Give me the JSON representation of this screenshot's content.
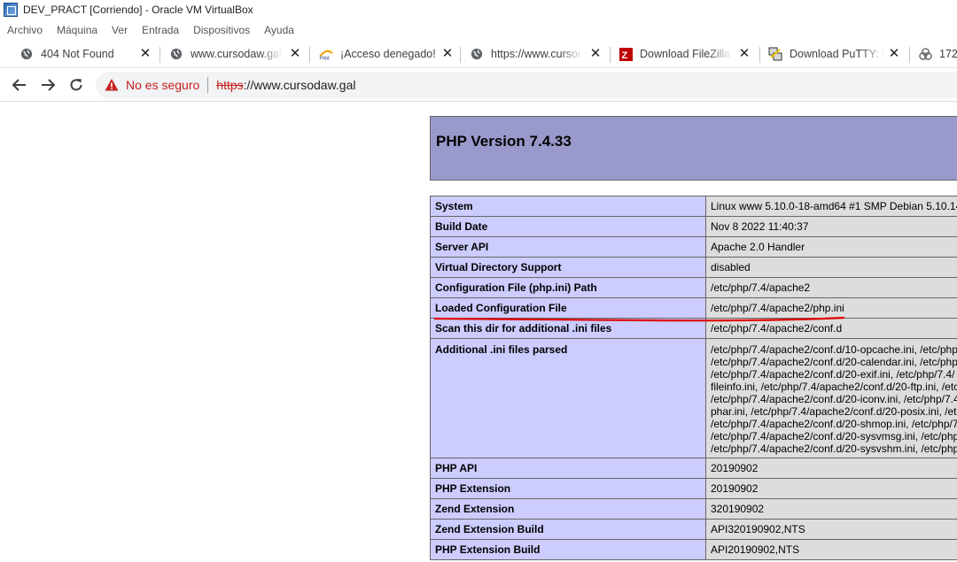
{
  "window": {
    "title": "DEV_PRACT [Corriendo] - Oracle VM VirtualBox",
    "menu": [
      "Archivo",
      "Máquina",
      "Ver",
      "Entrada",
      "Dispositivos",
      "Ayuda"
    ]
  },
  "tabs": [
    {
      "title": "404 Not Found",
      "icon": "globe-icon"
    },
    {
      "title": "www.cursodaw.galp",
      "icon": "globe-icon"
    },
    {
      "title": "¡Acceso denegado!",
      "icon": "phpmyadmin-icon"
    },
    {
      "title": "https://www.cursod",
      "icon": "globe-icon"
    },
    {
      "title": "Download FileZilla C",
      "icon": "filezilla-icon"
    },
    {
      "title": "Download PuTTY: la",
      "icon": "putty-icon"
    },
    {
      "title": "172",
      "icon": "biohazard-icon"
    }
  ],
  "address_bar": {
    "security_text": "No es seguro",
    "url_scheme": "https",
    "url_rest": "://www.cursodaw.gal"
  },
  "php": {
    "title": "PHP Version 7.4.33",
    "rows": [
      {
        "key": "System",
        "value": "Linux www 5.10.0-18-amd64 #1 SMP Debian 5.10.14"
      },
      {
        "key": "Build Date",
        "value": "Nov 8 2022 11:40:37"
      },
      {
        "key": "Server API",
        "value": "Apache 2.0 Handler"
      },
      {
        "key": "Virtual Directory Support",
        "value": "disabled"
      },
      {
        "key": "Configuration File (php.ini) Path",
        "value": "/etc/php/7.4/apache2"
      },
      {
        "key": "Loaded Configuration File",
        "value": "/etc/php/7.4/apache2/php.ini"
      },
      {
        "key": "Scan this dir for additional .ini files",
        "value": "/etc/php/7.4/apache2/conf.d"
      }
    ],
    "ini_files": {
      "key": "Additional .ini files parsed",
      "lines": [
        "/etc/php/7.4/apache2/conf.d/10-opcache.ini, /etc/php",
        "/etc/php/7.4/apache2/conf.d/20-calendar.ini, /etc/php",
        "/etc/php/7.4/apache2/conf.d/20-exif.ini, /etc/php/7.4/",
        "fileinfo.ini, /etc/php/7.4/apache2/conf.d/20-ftp.ini, /etc",
        "/etc/php/7.4/apache2/conf.d/20-iconv.ini, /etc/php/7.4",
        "phar.ini, /etc/php/7.4/apache2/conf.d/20-posix.ini, /etc",
        "/etc/php/7.4/apache2/conf.d/20-shmop.ini, /etc/php/7",
        "/etc/php/7.4/apache2/conf.d/20-sysvmsg.ini, /etc/php",
        "/etc/php/7.4/apache2/conf.d/20-sysvshm.ini, /etc/php"
      ]
    },
    "rows2": [
      {
        "key": "PHP API",
        "value": "20190902"
      },
      {
        "key": "PHP Extension",
        "value": "20190902"
      },
      {
        "key": "Zend Extension",
        "value": "320190902"
      },
      {
        "key": "Zend Extension Build",
        "value": "API320190902,NTS"
      },
      {
        "key": "PHP Extension Build",
        "value": "API20190902,NTS"
      }
    ]
  },
  "colors": {
    "php_header": "#9999cc",
    "php_key_cell": "#ccccff",
    "php_value_cell": "#dddddd",
    "annotation_red": "#e00000",
    "insecure_red": "#c5221f"
  }
}
